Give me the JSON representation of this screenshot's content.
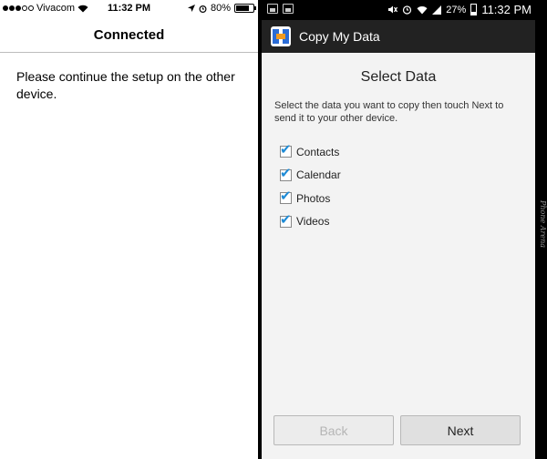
{
  "ios": {
    "carrier": "Vivacom",
    "time": "11:32 PM",
    "battery": "80%",
    "battery_level": 0.8,
    "nav_title": "Connected",
    "message": "Please continue the setup on the other device."
  },
  "android": {
    "battery": "27%",
    "battery_level": 0.27,
    "time": "11:32 PM",
    "app_title": "Copy My Data",
    "heading": "Select Data",
    "instructions": "Select the data you want to copy then touch Next to send it to your other device.",
    "options": [
      {
        "label": "Contacts",
        "checked": true
      },
      {
        "label": "Calendar",
        "checked": true
      },
      {
        "label": "Photos",
        "checked": true
      },
      {
        "label": "Videos",
        "checked": true
      }
    ],
    "back_label": "Back",
    "next_label": "Next",
    "accent_color": "#1e8bd6"
  },
  "watermark": "Phone Arena"
}
